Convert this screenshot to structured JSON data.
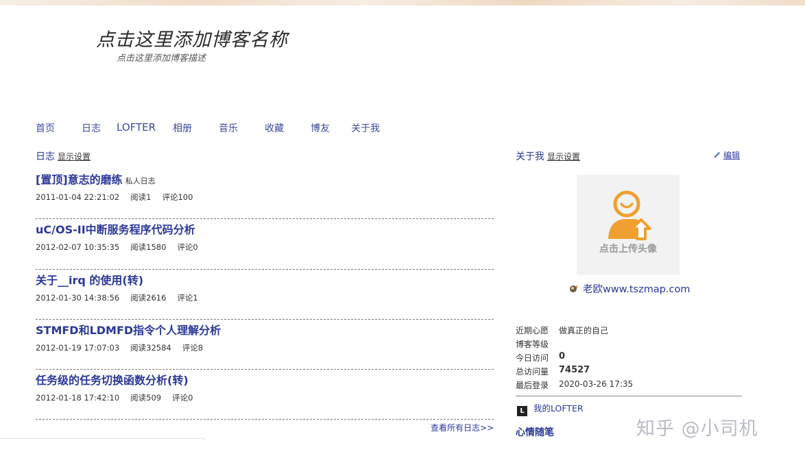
{
  "header": {
    "blog_title": "点击这里添加博客名称",
    "blog_description": "点击这里添加博客描述"
  },
  "nav": {
    "items": [
      {
        "label": "首页"
      },
      {
        "label": "日志"
      },
      {
        "label": "LOFTER"
      },
      {
        "label": "相册"
      },
      {
        "label": "音乐"
      },
      {
        "label": "收藏"
      },
      {
        "label": "博友"
      },
      {
        "label": "关于我"
      }
    ]
  },
  "blog_section": {
    "title": "日志",
    "display_settings": "显示设置",
    "view_all": "查看所有日志>>",
    "posts": [
      {
        "title": "[置顶]意志的磨练",
        "tag": "私人日志",
        "date": "2011-01-04 22:21:02",
        "reads": "阅读1",
        "comments": "评论100"
      },
      {
        "title": "uC/OS-II中断服务程序代码分析",
        "tag": "",
        "date": "2012-02-07 10:35:35",
        "reads": "阅读1580",
        "comments": "评论0"
      },
      {
        "title": "关于__irq 的使用(转)",
        "tag": "",
        "date": "2012-01-30 14:38:56",
        "reads": "阅读2616",
        "comments": "评论1"
      },
      {
        "title": "STMFD和LDMFD指令个人理解分析",
        "tag": "",
        "date": "2012-01-19 17:07:03",
        "reads": "阅读32584",
        "comments": "评论8"
      },
      {
        "title": "任务级的任务切换函数分析(转)",
        "tag": "",
        "date": "2012-01-18 17:42:10",
        "reads": "阅读509",
        "comments": "评论0"
      }
    ]
  },
  "about_section": {
    "title": "关于我",
    "display_settings": "显示设置",
    "edit_label": "编辑",
    "avatar_caption": "点击上传头像",
    "nickname": "老欧www.tszmap.com",
    "info": [
      {
        "key": "近期心愿",
        "value": "做真正的自己",
        "bold": false
      },
      {
        "key": "博客等级",
        "value": "",
        "bold": false
      },
      {
        "key": "今日访问",
        "value": "0",
        "bold": true
      },
      {
        "key": "总访问量",
        "value": "74527",
        "bold": true
      },
      {
        "key": "最后登录",
        "value": "2020-03-26 17:35",
        "bold": false
      }
    ],
    "lofter_link": "我的LOFTER",
    "lofter_icon_letter": "L",
    "mood_title": "心情随笔"
  },
  "watermark": "知乎 @小司机",
  "colors": {
    "link_blue": "#2b3896",
    "nav_blue": "#3d4a9e",
    "avatar_orange": "#f0a030"
  },
  "icons": {
    "edit": "pencil-icon",
    "avatar": "avatar-upload-icon",
    "nickname": "user-dot-icon",
    "lofter": "lofter-logo-icon"
  }
}
